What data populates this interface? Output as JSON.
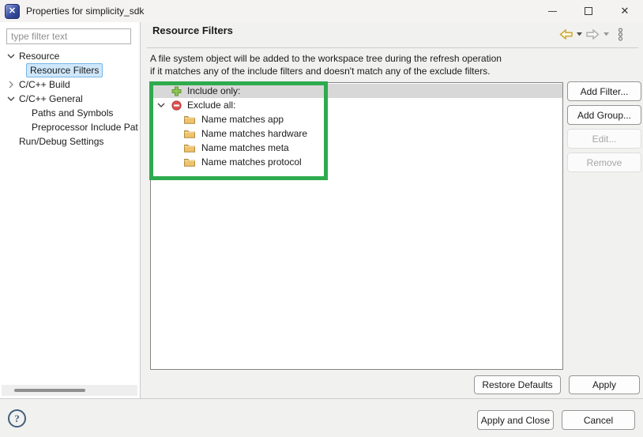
{
  "window": {
    "title": "Properties for simplicity_sdk",
    "app_icon_glyph": "✕"
  },
  "sidebar": {
    "filter_placeholder": "type filter text",
    "tree": [
      {
        "label": "Resource",
        "state": "expanded"
      },
      {
        "label": "Resource Filters",
        "selected": true
      },
      {
        "label": "C/C++ Build",
        "state": "collapsed"
      },
      {
        "label": "C/C++ General",
        "state": "expanded"
      },
      {
        "label": "Paths and Symbols"
      },
      {
        "label": "Preprocessor Include Pat"
      },
      {
        "label": "Run/Debug Settings"
      }
    ]
  },
  "header": {
    "title": "Resource Filters"
  },
  "description": {
    "line1": "A file system object will be added to the workspace tree during the refresh operation",
    "line2": "if it matches any of the include filters and doesn't match any of the exclude filters."
  },
  "filters": {
    "include_label": "Include only:",
    "exclude_label": "Exclude all:",
    "exclude_children": [
      "Name matches app",
      "Name matches hardware",
      "Name matches meta",
      "Name matches protocol"
    ]
  },
  "side_buttons": {
    "add_filter": "Add Filter...",
    "add_group": "Add Group...",
    "edit": "Edit...",
    "remove": "Remove"
  },
  "bottom_buttons": {
    "restore_defaults": "Restore Defaults",
    "apply": "Apply",
    "apply_and_close": "Apply and Close",
    "cancel": "Cancel"
  },
  "help": {
    "glyph": "?"
  },
  "icons": {
    "include": "green-plus-icon",
    "exclude": "red-no-entry-icon",
    "child": "folder-icon",
    "nav_back": "back-arrow-icon",
    "nav_forward": "forward-arrow-icon",
    "menu": "kebab-menu-icon"
  },
  "colors": {
    "annotation_green": "#2eab4e",
    "accent_blue": "#1273c4",
    "selected_row_gray": "#d8d8d8",
    "tree_selection_bg": "#cfe7fb",
    "tree_selection_border": "#79b7e3"
  }
}
